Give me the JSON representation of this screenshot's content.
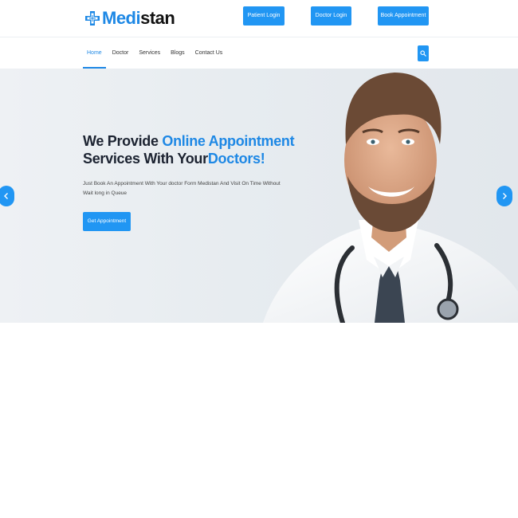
{
  "brand": {
    "part_a": "Medi",
    "part_b": "stan"
  },
  "top_buttons": {
    "patient_login": "Patient Login",
    "doctor_login": "Doctor Login",
    "book_appointment": "Book Appointment"
  },
  "nav": {
    "items": [
      "Home",
      "Doctor",
      "Services",
      "Blogs",
      "Contact Us"
    ],
    "active": "Home"
  },
  "hero": {
    "title_line1_prefix": "We Provide ",
    "title_line1_highlight": "Online Appointment",
    "title_line2_prefix": "Services With Your",
    "title_line2_highlight": "Doctors!",
    "subtitle": "Just Book An Appointment With Your doctor Form Medistan And Visit On Time Without Wait long in Queue",
    "cta": "Get Appointment"
  },
  "icons": {
    "logo": "medical-cross-icon",
    "search": "search-icon",
    "prev": "chevron-left-icon",
    "next": "chevron-right-icon"
  },
  "colors": {
    "accent": "#2196f3",
    "brand_blue": "#1e88e5",
    "title_dark": "#1c2331"
  }
}
